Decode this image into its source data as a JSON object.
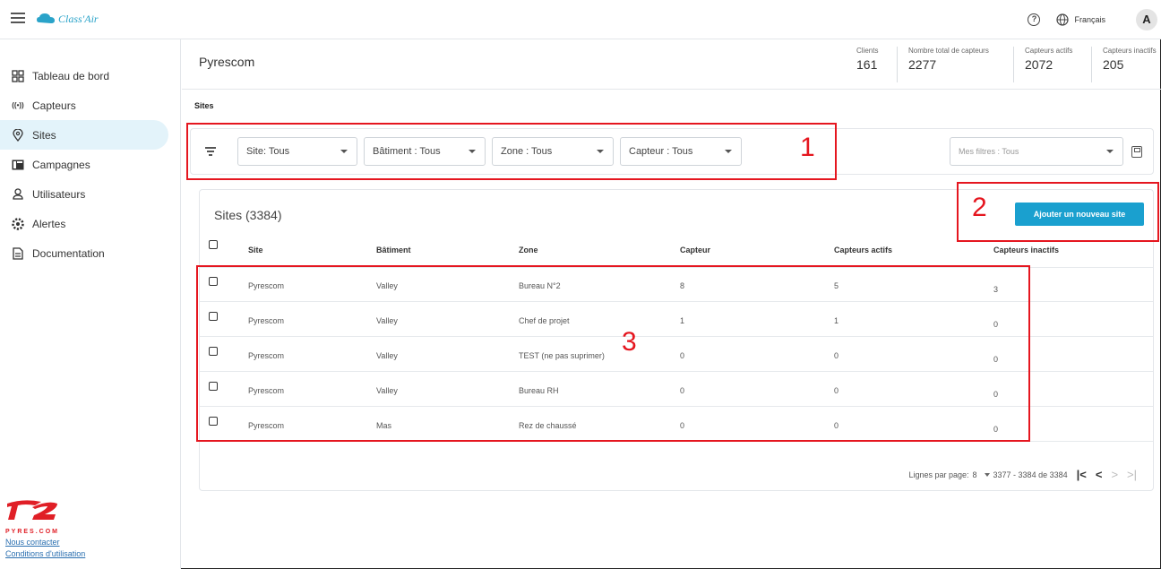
{
  "app": {
    "logo_text": "Class'Air",
    "brand_name": "PYRES.COM"
  },
  "topbar": {
    "help_glyph": "?",
    "language": "Français",
    "avatar_initial": "A"
  },
  "sidebar": {
    "items": [
      {
        "label": "Tableau de bord",
        "icon": "dashboard-icon",
        "active": false
      },
      {
        "label": "Capteurs",
        "icon": "sensor-icon",
        "active": false
      },
      {
        "label": "Sites",
        "icon": "location-pin-icon",
        "active": true
      },
      {
        "label": "Campagnes",
        "icon": "campaign-icon",
        "active": false
      },
      {
        "label": "Utilisateurs",
        "icon": "user-icon",
        "active": false
      },
      {
        "label": "Alertes",
        "icon": "gear-alert-icon",
        "active": false
      },
      {
        "label": "Documentation",
        "icon": "document-icon",
        "active": false
      }
    ],
    "contact_link": "Nous contacter",
    "terms_link": "Conditions d'utilisation"
  },
  "header": {
    "title": "Pyrescom",
    "stats": [
      {
        "label": "Clients",
        "value": "161"
      },
      {
        "label": "Nombre total de capteurs",
        "value": "2277"
      },
      {
        "label": "Capteurs actifs",
        "value": "2072"
      },
      {
        "label": "Capteurs inactifs",
        "value": "205"
      }
    ]
  },
  "breadcrumb": "Sites",
  "filters": {
    "site": "Site: Tous",
    "batiment": "Bâtiment : Tous",
    "zone": "Zone : Tous",
    "capteur": "Capteur : Tous",
    "saved_filters_placeholder": "Mes filtres : Tous"
  },
  "table": {
    "title": "Sites (3384)",
    "add_button": "Ajouter un nouveau site",
    "columns": [
      "Site",
      "Bâtiment",
      "Zone",
      "Capteur",
      "Capteurs actifs",
      "Capteurs inactifs"
    ],
    "rows": [
      [
        "Pyrescom",
        "Valley",
        "Bureau N°2",
        "8",
        "5",
        "3"
      ],
      [
        "Pyrescom",
        "Valley",
        "Chef de projet",
        "1",
        "1",
        "0"
      ],
      [
        "Pyrescom",
        "Valley",
        "TEST (ne pas suprimer)",
        "0",
        "0",
        "0"
      ],
      [
        "Pyrescom",
        "Valley",
        "Bureau RH",
        "0",
        "0",
        "0"
      ],
      [
        "Pyrescom",
        "Mas",
        "Rez de chaussé",
        "0",
        "0",
        "0"
      ]
    ],
    "pagination": {
      "rows_per_page_label": "Lignes par page:",
      "rows_per_page": "8",
      "range": "3377 - 3384 de 3384"
    }
  },
  "annotations": {
    "one": "1",
    "two": "2",
    "three": "3",
    "color": "#e5161f"
  },
  "colors": {
    "accent": "#1aa0cf",
    "active_nav_bg": "#e3f3fa"
  }
}
